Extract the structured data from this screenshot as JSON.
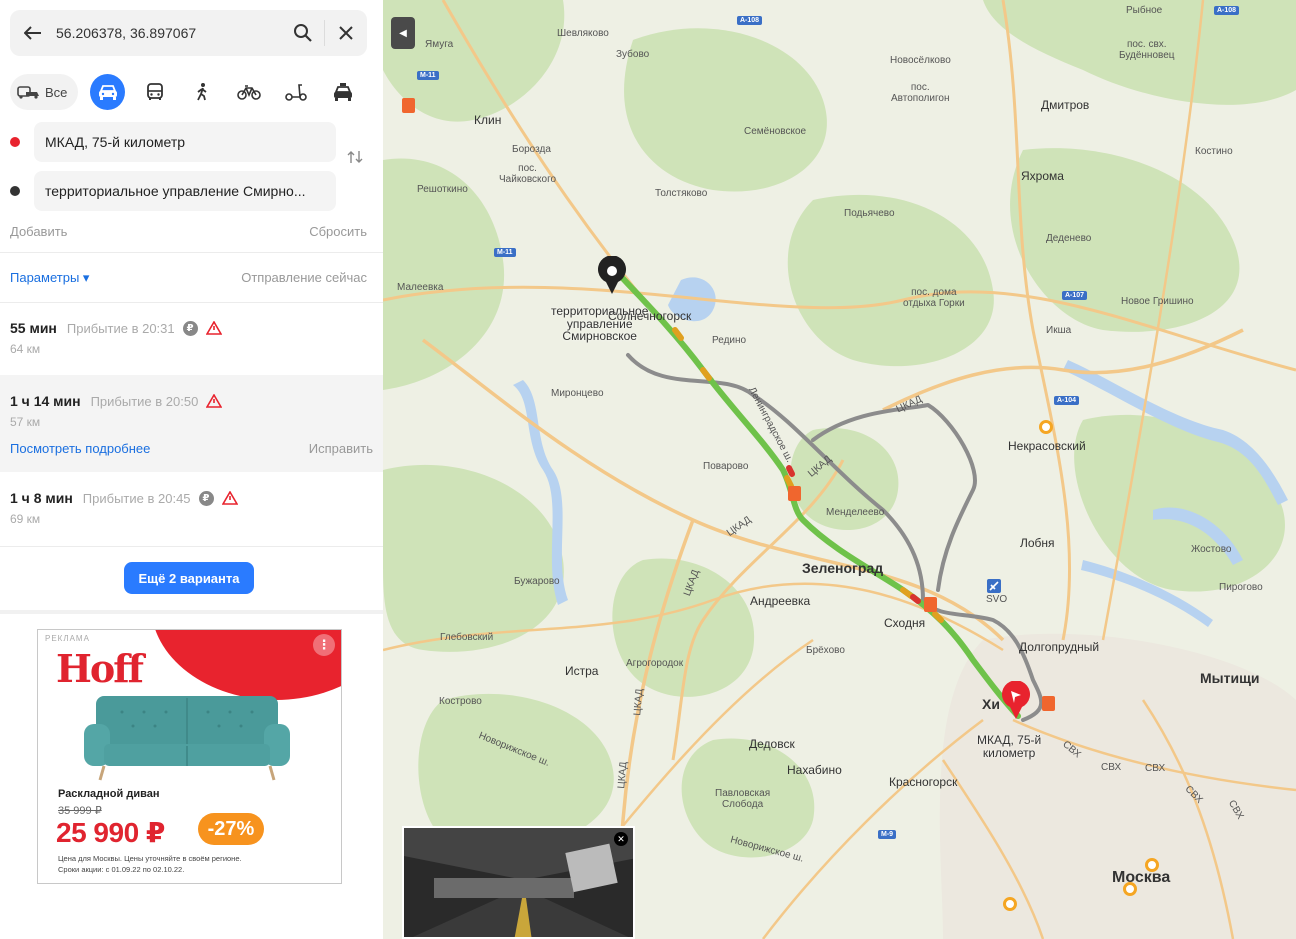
{
  "search": {
    "query": "56.206378, 36.897067"
  },
  "modes": {
    "all_label": "Все",
    "items": [
      "car",
      "bus",
      "walk",
      "bike",
      "scooter",
      "taxi"
    ],
    "active": "car"
  },
  "route_points": [
    {
      "text": "МКАД, 75-й километр",
      "color": "#e8232e"
    },
    {
      "text": "территориальное управление Смирно...",
      "color": "#333333"
    }
  ],
  "actions": {
    "add": "Добавить",
    "reset": "Сбросить"
  },
  "params": {
    "label": "Параметры ▾",
    "departure": "Отправление сейчас"
  },
  "routes": [
    {
      "duration": "55 мин",
      "arrival": "Прибытие в 20:31",
      "distance": "64 км",
      "toll": true,
      "warning": true
    },
    {
      "duration": "1 ч 14 мин",
      "arrival": "Прибытие в 20:50",
      "distance": "57 км",
      "toll": false,
      "warning": true,
      "details": "Посмотреть подробнее",
      "fix": "Исправить"
    },
    {
      "duration": "1 ч 8 мин",
      "arrival": "Прибытие в 20:45",
      "distance": "69 км",
      "toll": true,
      "warning": true
    }
  ],
  "more_button": "Ещё 2 варианта",
  "ad": {
    "label": "РЕКЛАМА",
    "brand": "Hoff",
    "product": "Раскладной диван",
    "old_price": "35 999 ₽",
    "price": "25 990 ₽",
    "discount": "-27%",
    "note1": "Цена для Москвы. Цены уточняйте в своём регионе.",
    "note2": "Сроки акции: с 01.09.22 по 02.10.22.",
    "accent": "#e8232e"
  },
  "map": {
    "places": [
      {
        "name": "Ямуга",
        "size": "sm"
      },
      {
        "name": "Шевляково",
        "size": "sm"
      },
      {
        "name": "Зубово",
        "size": "sm"
      },
      {
        "name": "Клин",
        "size": "md"
      },
      {
        "name": "Борозда",
        "size": "sm"
      },
      {
        "name": "пос.\nЧайковского",
        "size": "sm"
      },
      {
        "name": "Решоткино",
        "size": "sm"
      },
      {
        "name": "Толстяково",
        "size": "sm"
      },
      {
        "name": "Семёновское",
        "size": "sm"
      },
      {
        "name": "Новосёлково",
        "size": "sm"
      },
      {
        "name": "пос.\nАвтополигон",
        "size": "sm"
      },
      {
        "name": "Дмитров",
        "size": "md"
      },
      {
        "name": "Рыбное",
        "size": "sm"
      },
      {
        "name": "пос. свх.\nБудённовец",
        "size": "sm"
      },
      {
        "name": "Костино",
        "size": "sm"
      },
      {
        "name": "Яхрома",
        "size": "md"
      },
      {
        "name": "Подьячево",
        "size": "sm"
      },
      {
        "name": "Деденево",
        "size": "sm"
      },
      {
        "name": "Малеевка",
        "size": "sm"
      },
      {
        "name": "Солнечногорск",
        "size": "sm"
      },
      {
        "name": "Редино",
        "size": "sm"
      },
      {
        "name": "пос. дома\nотдыха Горки",
        "size": "sm"
      },
      {
        "name": "Новое Гришино",
        "size": "sm"
      },
      {
        "name": "Икша",
        "size": "sm"
      },
      {
        "name": "Миронцево",
        "size": "sm"
      },
      {
        "name": "Некрасовский",
        "size": "md"
      },
      {
        "name": "Поварово",
        "size": "sm"
      },
      {
        "name": "Менделеево",
        "size": "sm"
      },
      {
        "name": "Лобня",
        "size": "md"
      },
      {
        "name": "Жостово",
        "size": "sm"
      },
      {
        "name": "Пирогово",
        "size": "sm"
      },
      {
        "name": "Бужарово",
        "size": "sm"
      },
      {
        "name": "Зеленоград",
        "size": "lg"
      },
      {
        "name": "Андреевка",
        "size": "md"
      },
      {
        "name": "Сходня",
        "size": "md"
      },
      {
        "name": "SVO",
        "size": "sm"
      },
      {
        "name": "Глебовский",
        "size": "sm"
      },
      {
        "name": "Брёхово",
        "size": "sm"
      },
      {
        "name": "Долгопрудный",
        "size": "md"
      },
      {
        "name": "Мытищи",
        "size": "lg"
      },
      {
        "name": "Истра",
        "size": "md"
      },
      {
        "name": "Агрогородок",
        "size": "sm"
      },
      {
        "name": "Кострово",
        "size": "sm"
      },
      {
        "name": "Хи",
        "size": "lg"
      },
      {
        "name": "Дедовск",
        "size": "md"
      },
      {
        "name": "Нахабино",
        "size": "md"
      },
      {
        "name": "Красногорск",
        "size": "md"
      },
      {
        "name": "Павловская\nСлобода",
        "size": "sm"
      },
      {
        "name": "Москва",
        "size": "lg"
      }
    ],
    "road_labels": [
      "ЦКАД",
      "ЦКАД",
      "ЦКАД",
      "ЦКАД",
      "ЦКАД",
      "ЦКАД",
      "Ленинградское ш.",
      "Новорижское ш.",
      "Новорижское ш.",
      "СВХ",
      "СВХ",
      "СВХ",
      "СВХ",
      "СВХ"
    ],
    "shields": [
      "А-108",
      "М-11",
      "М-11",
      "А-107",
      "А-104",
      "М-9",
      "А-108"
    ],
    "start_pin_label": "территориальное\nуправление\nСмирновское",
    "end_pin_label": "МКАД, 75-й\nкилометр",
    "colors": {
      "route_green": "#6fc24a",
      "route_alt": "#8c8c8c",
      "water": "#b7d2f0",
      "forest": "#cfe3b8",
      "road": "#f3c889"
    }
  }
}
